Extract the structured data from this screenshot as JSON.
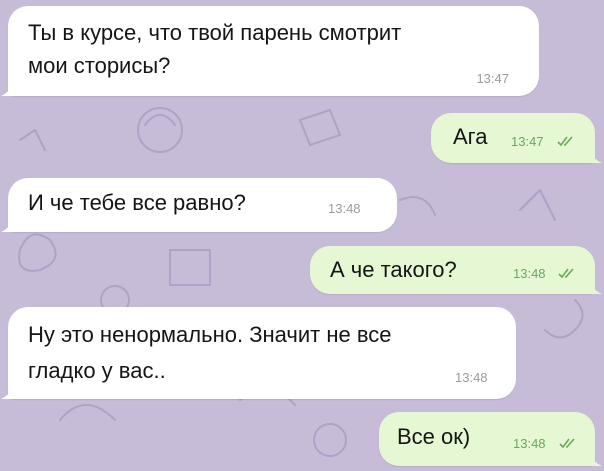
{
  "theme": {
    "background": "#c7bcd8",
    "incoming_bubble": "#ffffff",
    "outgoing_bubble": "#e6f7d3",
    "outgoing_time_color": "#6aa85a",
    "incoming_time_color": "#9a9a9a"
  },
  "messages": [
    {
      "direction": "incoming",
      "lines": [
        "Ты в курсе, что твой парень смотрит",
        "мои сторисы?"
      ],
      "time": "13:47"
    },
    {
      "direction": "outgoing",
      "lines": [
        "Ага"
      ],
      "time": "13:47",
      "status_icon": "double-check-icon"
    },
    {
      "direction": "incoming",
      "lines": [
        "И че тебе все равно?"
      ],
      "time": "13:48"
    },
    {
      "direction": "outgoing",
      "lines": [
        "А че такого?"
      ],
      "time": "13:48",
      "status_icon": "double-check-icon"
    },
    {
      "direction": "incoming",
      "lines": [
        "Ну это ненормально. Значит не все",
        "гладко у вас.."
      ],
      "time": "13:48"
    },
    {
      "direction": "outgoing",
      "lines": [
        "Все ок)"
      ],
      "time": "13:48",
      "status_icon": "double-check-icon"
    }
  ]
}
